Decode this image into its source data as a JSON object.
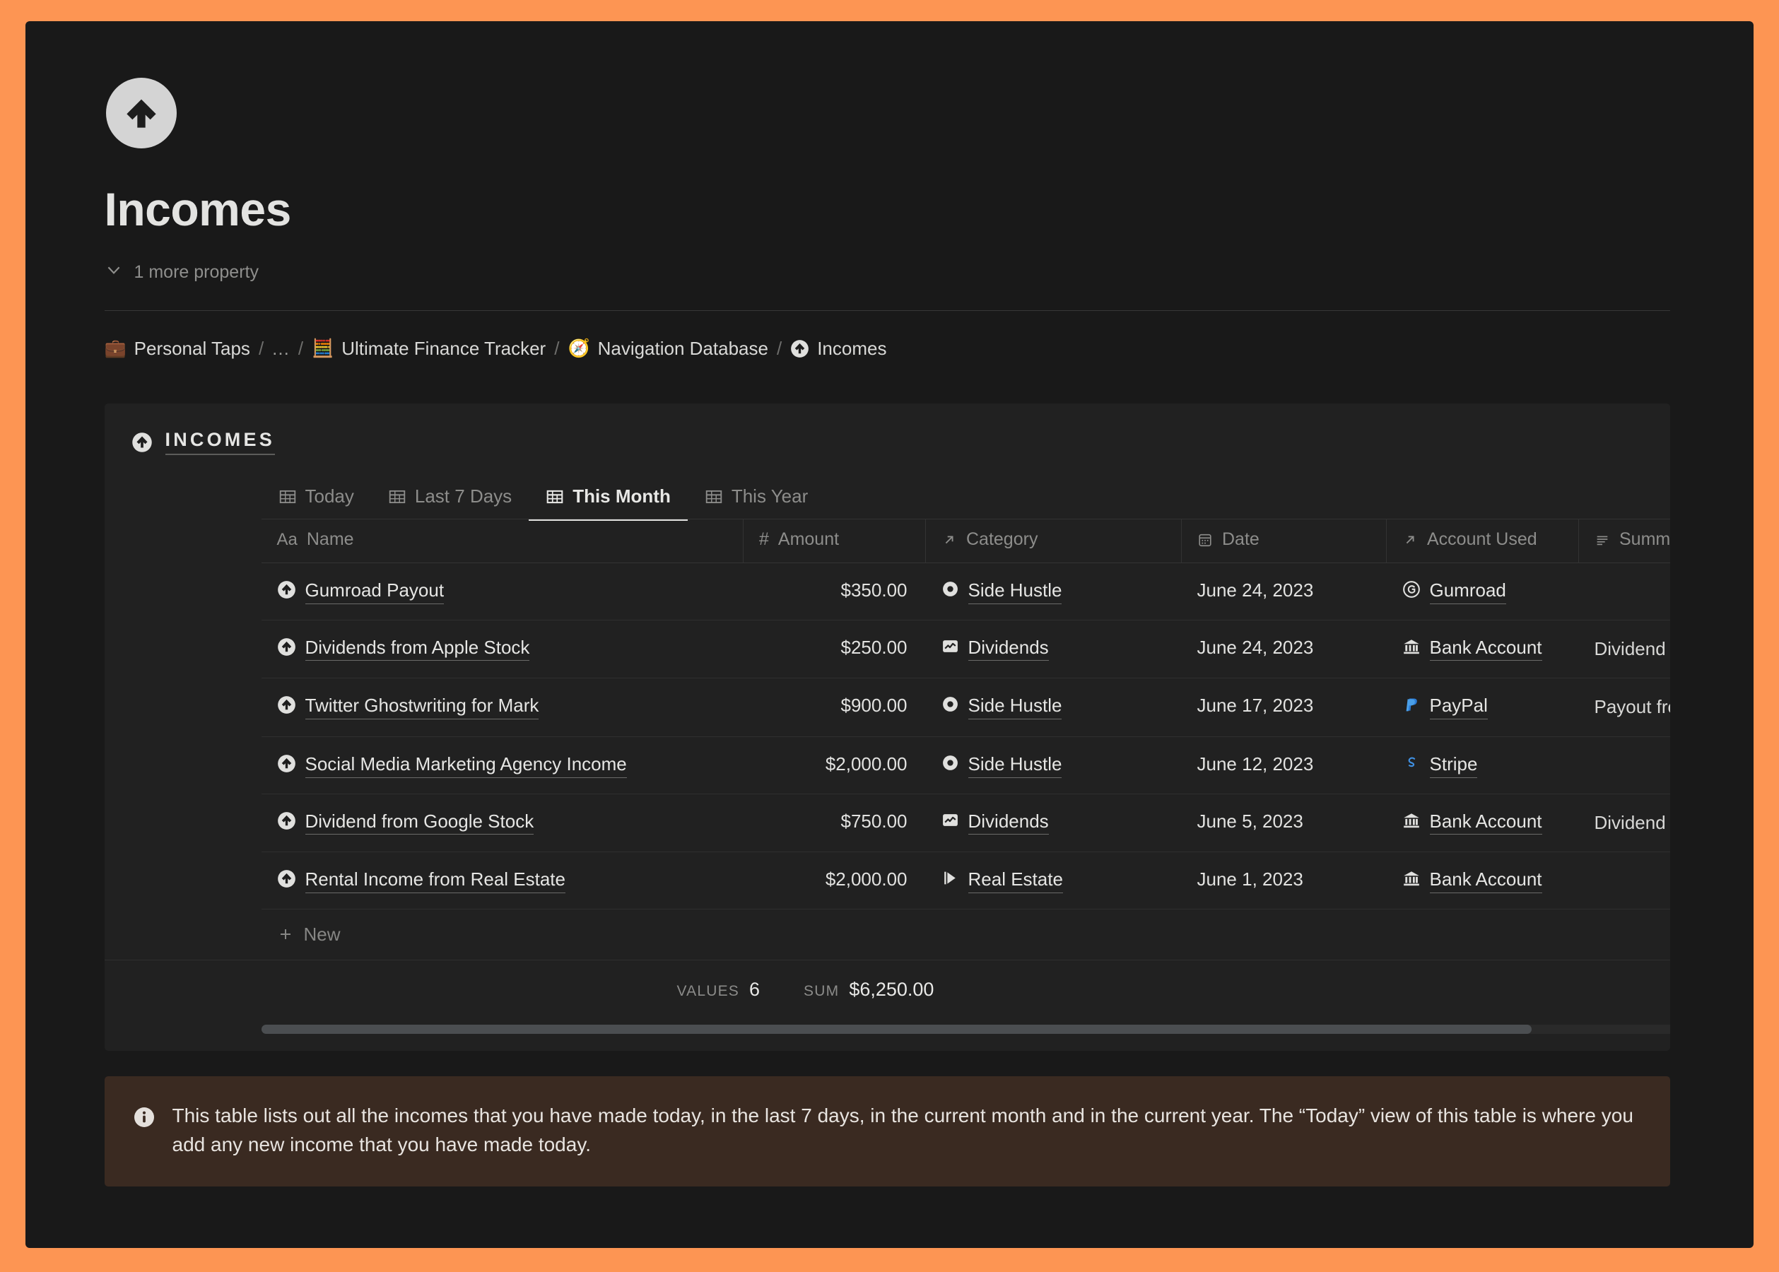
{
  "theme": {
    "frame_color": "#fd9553",
    "page_bg": "#191919",
    "block_bg": "#212121",
    "callout_bg": "#3a2a21",
    "accent_blue": "#5c9ded"
  },
  "page": {
    "icon": "up-arrow-circle-icon",
    "title": "Incomes",
    "more_properties_label": "1 more property"
  },
  "breadcrumb": {
    "items": [
      {
        "icon": "briefcase-emoji",
        "emoji": "💼",
        "label": "Personal Taps"
      },
      {
        "icon": "ellipsis-icon",
        "label": "..."
      },
      {
        "icon": "abacus-emoji",
        "emoji": "🧮",
        "label": "Ultimate Finance Tracker"
      },
      {
        "icon": "compass-emoji",
        "emoji": "🧭",
        "label": "Navigation Database"
      },
      {
        "icon": "up-arrow-circle-icon",
        "label": "Incomes"
      }
    ],
    "separator": "/"
  },
  "database": {
    "icon": "up-arrow-circle-icon",
    "title": "INCOMES",
    "tabs": [
      {
        "label": "Today",
        "icon": "table-icon",
        "active": false
      },
      {
        "label": "Last 7 Days",
        "icon": "table-icon",
        "active": false
      },
      {
        "label": "This Month",
        "icon": "table-icon",
        "active": true
      },
      {
        "label": "This Year",
        "icon": "table-icon",
        "active": false
      }
    ],
    "columns": [
      {
        "key": "name",
        "label": "Name",
        "icon": "title-aa-icon"
      },
      {
        "key": "amount",
        "label": "Amount",
        "icon": "number-hash-icon"
      },
      {
        "key": "category",
        "label": "Category",
        "icon": "relation-arrow-icon"
      },
      {
        "key": "date",
        "label": "Date",
        "icon": "calendar-icon"
      },
      {
        "key": "account",
        "label": "Account Used",
        "icon": "relation-arrow-icon"
      },
      {
        "key": "summary",
        "label": "Summary",
        "icon": "text-lines-icon"
      }
    ],
    "rows": [
      {
        "name": "Gumroad Payout",
        "amount": "$350.00",
        "category": "Side Hustle",
        "category_icon": "donut-circle-icon",
        "date": "June 24, 2023",
        "account": "Gumroad",
        "account_icon": "gumroad-icon",
        "summary": ""
      },
      {
        "name": "Dividends from Apple Stock",
        "amount": "$250.00",
        "category": "Dividends",
        "category_icon": "chart-squiggle-icon",
        "date": "June 24, 2023",
        "account": "Bank Account",
        "account_icon": "bank-icon",
        "summary": "Dividend payment re… investments in Apple"
      },
      {
        "name": "Twitter Ghostwriting for Mark",
        "amount": "$900.00",
        "category": "Side Hustle",
        "category_icon": "donut-circle-icon",
        "date": "June 17, 2023",
        "account": "PayPal",
        "account_icon": "paypal-icon",
        "summary": "Payout from Twitter … Agency for one of my"
      },
      {
        "name": "Social Media Marketing Agency Income",
        "amount": "$2,000.00",
        "category": "Side Hustle",
        "category_icon": "donut-circle-icon",
        "date": "June 12, 2023",
        "account": "Stripe",
        "account_icon": "stripe-icon",
        "summary": ""
      },
      {
        "name": "Dividend from Google Stock",
        "amount": "$750.00",
        "category": "Dividends",
        "category_icon": "chart-squiggle-icon",
        "date": "June 5, 2023",
        "account": "Bank Account",
        "account_icon": "bank-icon",
        "summary": "Dividend payment re… investments in Googl"
      },
      {
        "name": "Rental Income from Real Estate",
        "amount": "$2,000.00",
        "category": "Real Estate",
        "category_icon": "flag-play-icon",
        "date": "June 1, 2023",
        "account": "Bank Account",
        "account_icon": "bank-icon",
        "summary": ""
      }
    ],
    "new_row_label": "New",
    "aggregates": {
      "values_label": "VALUES",
      "values_count": "6",
      "sum_label": "SUM",
      "sum_value": "$6,250.00"
    }
  },
  "callout": {
    "icon": "info-icon",
    "text": "This table lists out all the incomes that you have made today, in the last 7 days, in the current month and in the current year. The “Today” view of this table is where you add any new income that you have made today."
  }
}
